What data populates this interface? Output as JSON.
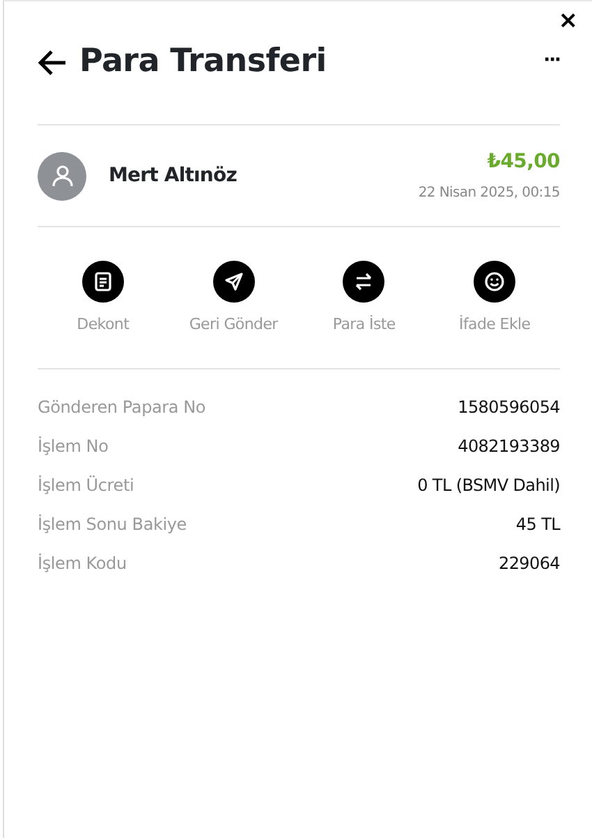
{
  "close_label": "×",
  "header": {
    "title": "Para Transferi",
    "menu_label": "···"
  },
  "transaction": {
    "name": "Mert Altınöz",
    "amount": "₺45,00",
    "date": "22 Nisan 2025, 00:15"
  },
  "actions": [
    {
      "kind": "receipt",
      "label": "Dekont"
    },
    {
      "kind": "send",
      "label": "Geri Gönder"
    },
    {
      "kind": "swap",
      "label": "Para İste"
    },
    {
      "kind": "emoji",
      "label": "İfade Ekle"
    }
  ],
  "details": [
    {
      "label": "Gönderen Papara No",
      "value": "1580596054"
    },
    {
      "label": "İşlem No",
      "value": "4082193389"
    },
    {
      "label": "İşlem Ücreti",
      "value": "0 TL (BSMV Dahil)"
    },
    {
      "label": "İşlem Sonu Bakiye",
      "value": "45 TL"
    },
    {
      "label": "İşlem Kodu",
      "value": "229064"
    }
  ]
}
